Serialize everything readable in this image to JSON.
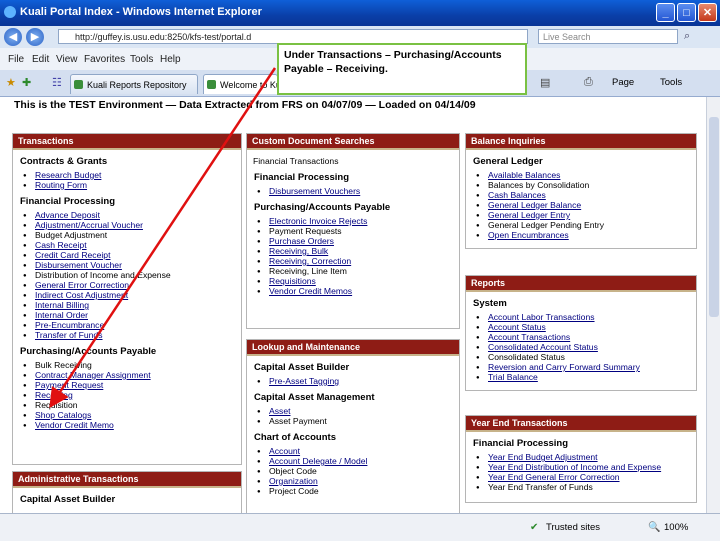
{
  "window": {
    "title": "Kuali Portal Index - Windows Internet Explorer",
    "min": "_",
    "max": "□",
    "close": "✕"
  },
  "address": {
    "url": "http://guffey.is.usu.edu:8250/kfs-test/portal.d",
    "search_placeholder": "Live Search"
  },
  "menu": [
    "File",
    "Edit",
    "View",
    "Favorites",
    "Tools",
    "Help"
  ],
  "tabs": [
    {
      "label": "Kuali Reports Repository"
    },
    {
      "label": "Welcome to Ku"
    }
  ],
  "toolbar_right": {
    "page": "Page",
    "tools": "Tools"
  },
  "env_banner": "This is the TEST Environment — Data Extracted from FRS on 04/07/09 — Loaded on 04/14/09",
  "status": {
    "zone": "Trusted sites",
    "zoom": "100%"
  },
  "callout": "Under Transactions – Purchasing/Accounts Payable – Receiving.",
  "col1": {
    "header": "Transactions",
    "sections": [
      {
        "title": "Contracts & Grants",
        "items": [
          "Research Budget",
          "Routing Form"
        ]
      },
      {
        "title": "Financial Processing",
        "items": [
          "Advance Deposit",
          "Adjustment/Accrual Voucher",
          "Budget Adjustment",
          "Cash Receipt",
          "Credit Card Receipt",
          "Disbursement Voucher",
          "Distribution of Income and Expense",
          "General Error Correction",
          "Indirect Cost Adjustment",
          "Internal Billing",
          "Internal Order",
          "Pre-Encumbrance",
          "Transfer of Funds"
        ]
      },
      {
        "title": "Purchasing/Accounts Payable",
        "items": [
          "Bulk Receiving",
          "Contract Manager Assignment",
          "Payment Request",
          "Receiving",
          "Requisition",
          "Shop Catalogs",
          "Vendor Credit Memo"
        ]
      }
    ],
    "header2": "Administrative Transactions",
    "sect2": "Capital Asset Builder"
  },
  "col2": {
    "header": "Custom Document Searches",
    "sections": [
      {
        "title": "",
        "items": [
          "Financial Transactions"
        ]
      },
      {
        "title": "Financial Processing",
        "items": [
          "Disbursement Vouchers"
        ]
      },
      {
        "title": "Purchasing/Accounts Payable",
        "items": [
          "Electronic Invoice Rejects",
          "Payment Requests",
          "Purchase Orders",
          "Receiving, Bulk",
          "Receiving, Correction",
          "Receiving, Line Item",
          "Requisitions",
          "Vendor Credit Memos"
        ]
      }
    ],
    "header2": "Lookup and Maintenance",
    "sections2": [
      {
        "title": "Capital Asset Builder",
        "items": [
          "Pre-Asset Tagging"
        ]
      },
      {
        "title": "Capital Asset Management",
        "items": [
          "Asset",
          "Asset Payment"
        ]
      },
      {
        "title": "Chart of Accounts",
        "items": [
          "Account",
          "Account Delegate / Model",
          "Object Code",
          "Organization",
          "Project Code"
        ]
      }
    ]
  },
  "col3": {
    "header": "Balance Inquiries",
    "sections": [
      {
        "title": "General Ledger",
        "items": [
          "Available Balances",
          "Balances by Consolidation",
          "Cash Balances",
          "General Ledger Balance",
          "General Ledger Entry",
          "General Ledger Pending Entry",
          "Open Encumbrances"
        ]
      }
    ],
    "header2": "Reports",
    "sections2": [
      {
        "title": "System",
        "items": [
          "Account Labor Transactions",
          "Account Status",
          "Account Transactions",
          "Consolidated Account Status",
          "Consolidated Status",
          "Reversion and Carry Forward Summary",
          "Trial Balance"
        ]
      }
    ],
    "header3": "Year End Transactions",
    "sections3": [
      {
        "title": "Financial Processing",
        "items": [
          "Year End Budget Adjustment",
          "Year End Distribution of Income and Expense",
          "Year End General Error Correction",
          "Year End Transfer of Funds"
        ]
      }
    ]
  }
}
